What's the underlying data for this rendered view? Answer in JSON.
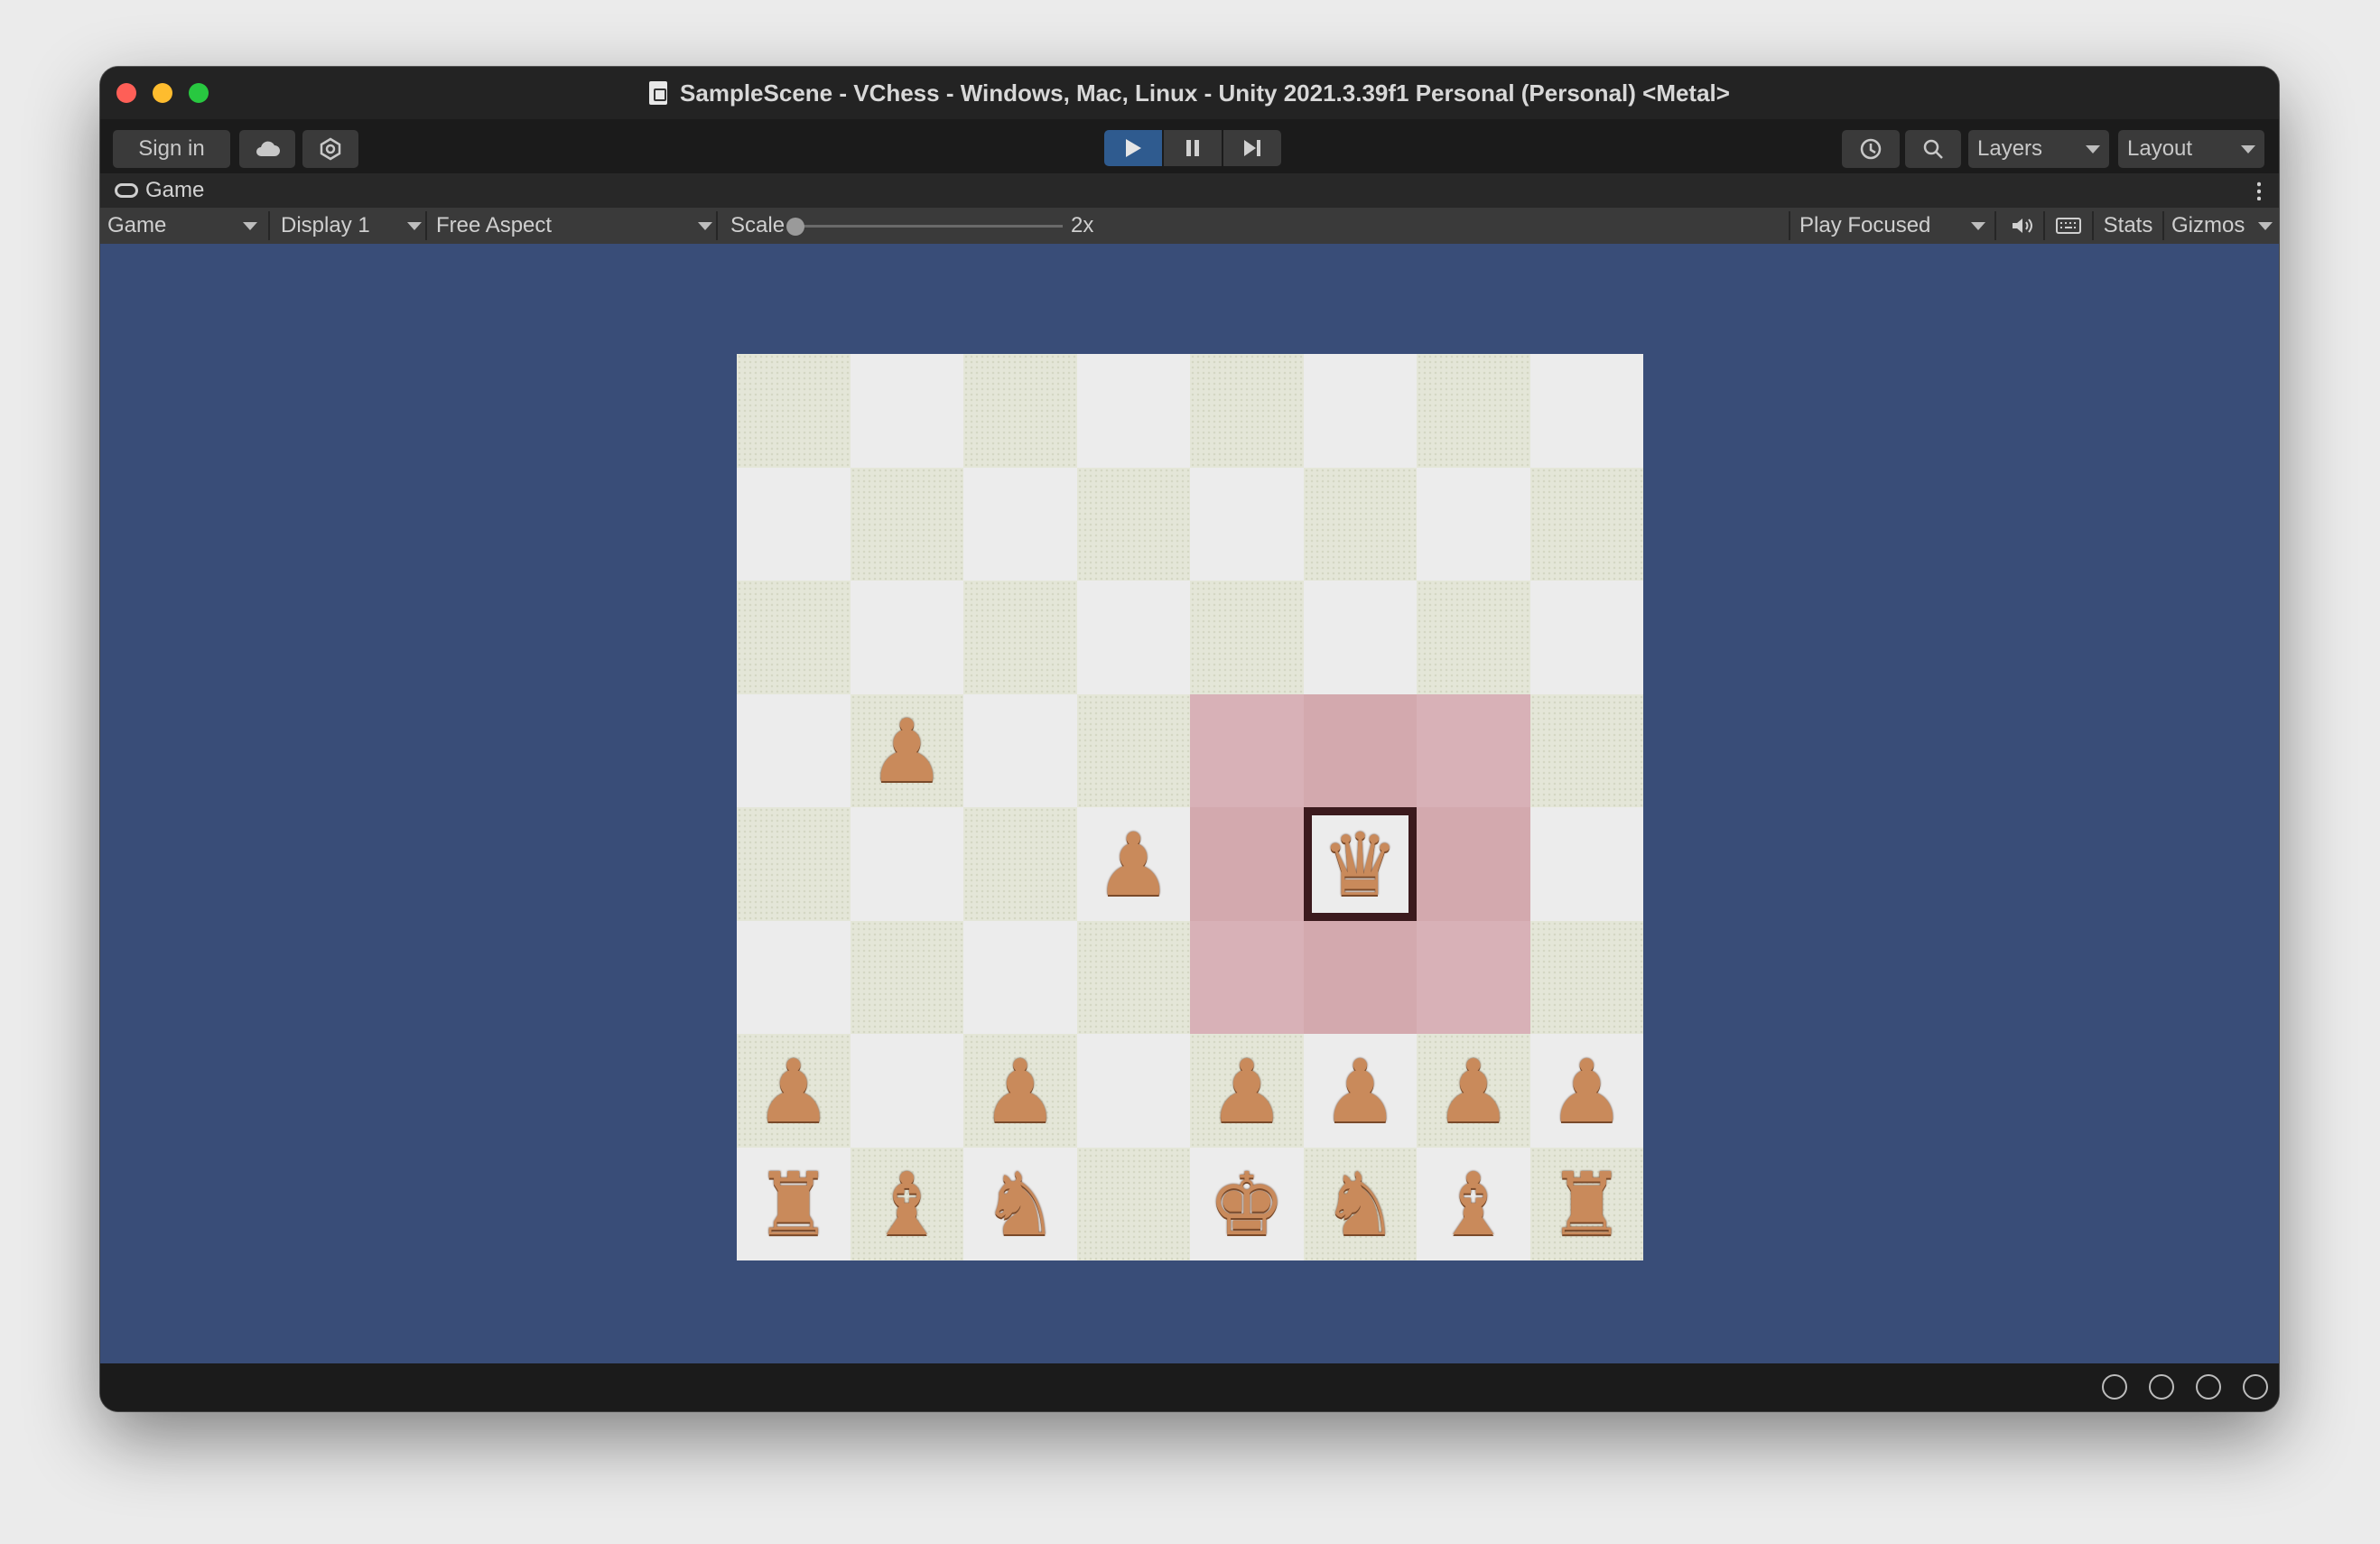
{
  "window": {
    "title": "SampleScene - VChess - Windows, Mac, Linux - Unity 2021.3.39f1 Personal (Personal) <Metal>"
  },
  "toolbar": {
    "sign_in": "Sign in",
    "cloud_icon": "cloud-icon",
    "collab_icon": "collab-icon",
    "play_icon": "play-icon",
    "pause_icon": "pause-icon",
    "step_icon": "step-icon",
    "history_icon": "history-icon",
    "search_icon": "search-icon",
    "layers_label": "Layers",
    "layout_label": "Layout"
  },
  "tab": {
    "label": "Game"
  },
  "gamebar": {
    "mode": "Game",
    "display": "Display 1",
    "aspect": "Free Aspect",
    "scale_label": "Scale",
    "scale_value": "2x",
    "play_focused": "Play Focused",
    "stats": "Stats",
    "gizmos": "Gizmos"
  },
  "board": {
    "rows": [
      [
        "",
        "",
        "",
        "",
        "",
        "",
        "",
        ""
      ],
      [
        "",
        "",
        "",
        "",
        "",
        "",
        "",
        ""
      ],
      [
        "",
        "",
        "",
        "",
        "",
        "",
        "",
        ""
      ],
      [
        "",
        "♟",
        "",
        "",
        "",
        "",
        "",
        ""
      ],
      [
        "",
        "",
        "",
        "♟",
        "",
        "♛",
        "",
        ""
      ],
      [
        "",
        "",
        "",
        "",
        "",
        "",
        "",
        ""
      ],
      [
        "♟",
        "",
        "♟",
        "",
        "♟",
        "♟",
        "♟",
        "♟"
      ],
      [
        "♜",
        "♝",
        "♞",
        "",
        "♚",
        "♞",
        "♝",
        "♜"
      ]
    ],
    "selected": "queen on f4",
    "colors": {
      "light": "#ececec",
      "dark": "#e4e6d8",
      "highlight": "#d8b1b7",
      "selected_border": "#3b1a1d",
      "background": "#394d78"
    }
  }
}
